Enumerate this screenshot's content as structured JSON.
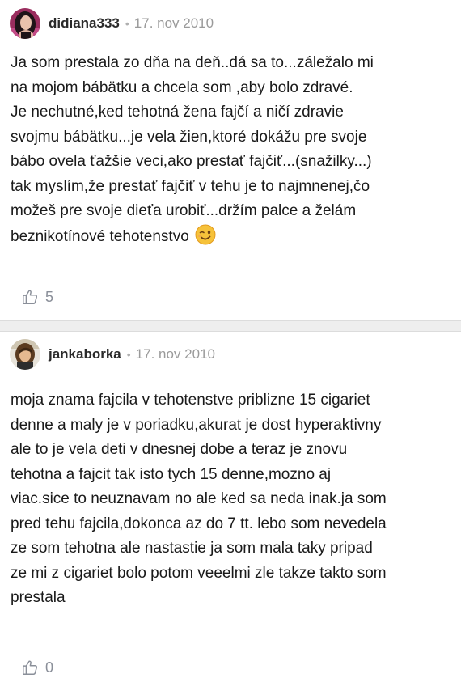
{
  "posts": [
    {
      "username": "didiana333",
      "separator": "•",
      "date": "17. nov 2010",
      "lines": [
        "Ja som prestala zo dňa na deň..dá sa to...záležalo mi",
        "na mojom bábätku a chcela som ,aby bolo zdravé.",
        "Je nechutné,ked tehotná žena fajčí a ničí zdravie",
        "svojmu bábätku...je vela žien,ktoré dokážu pre svoje",
        "bábo ovela ťažšie veci,ako prestať fajčiť...(snažilky...)",
        "tak myslím,že prestať fajčiť v tehu je to najmnenej,čo",
        "možeš pre svoje dieťa urobiť...držím palce a želám",
        "beznikotínové tehotenstvo"
      ],
      "emoji": "winking-face-icon",
      "likes": "5"
    },
    {
      "username": "jankaborka",
      "separator": "•",
      "date": "17. nov 2010",
      "lines": [
        "moja znama fajcila v tehotenstve priblizne 15 cigariet",
        "denne a maly je v poriadku,akurat je dost hyperaktivny",
        "ale to je vela deti v dnesnej dobe a teraz je znovu",
        "tehotna a fajcit tak isto tych 15 denne,mozno aj",
        "viac.sice to neuznavam no ale ked sa neda inak.ja som",
        "pred tehu fajcila,dokonca az do 7 tt. lebo som nevedela",
        "ze som tehotna ale nastastie ja som mala taky pripad",
        "ze mi z cigariet bolo potom veeelmi zle takze takto som",
        "prestala"
      ],
      "likes": "0"
    }
  ],
  "colors": {
    "text": "#1a1a1a",
    "username": "#2a2a2a",
    "meta": "#9a9a9a",
    "like": "#8a8f99",
    "divider": "#eeeeee"
  }
}
